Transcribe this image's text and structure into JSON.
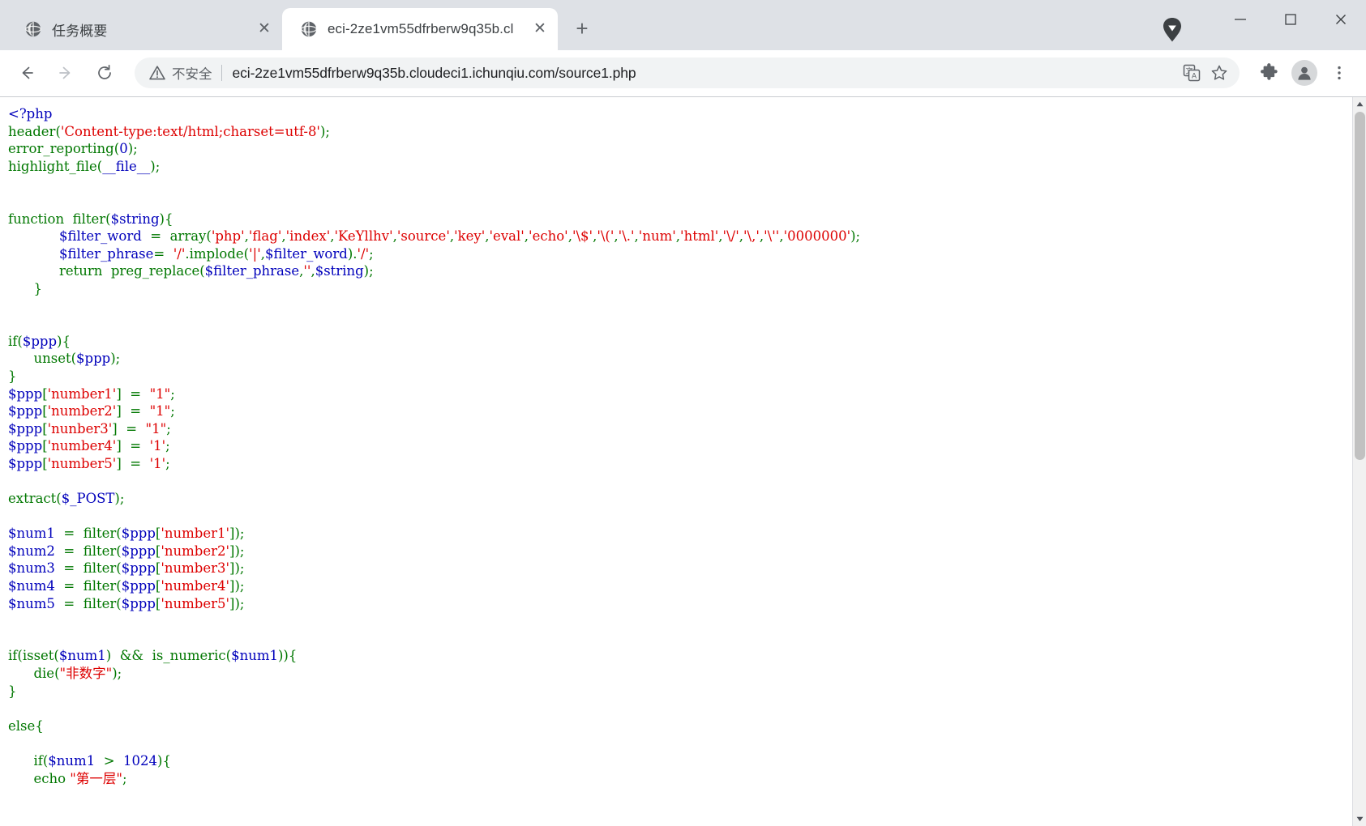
{
  "window": {
    "controls": {
      "minimize_label": "─",
      "maximize_label": "❐",
      "close_label": "✕"
    }
  },
  "tabstrip": {
    "tabs": [
      {
        "title": "任务概要",
        "favicon": "globe-icon",
        "close_label": "✕",
        "active": false
      },
      {
        "title": "eci-2ze1vm55dfrberw9q35b.cl",
        "favicon": "globe-icon",
        "close_label": "✕",
        "active": true
      }
    ],
    "new_tab_label": "+"
  },
  "toolbar": {
    "back_label": "←",
    "forward_label": "→",
    "reload_label": "↻",
    "security": {
      "icon": "warning-triangle-icon",
      "text": "不安全"
    },
    "url": "eci-2ze1vm55dfrberw9q35b.cloudeci1.ichunqiu.com/source1.php",
    "translate_icon": "translate-icon",
    "bookmark_icon": "star-icon",
    "extensions_icon": "puzzle-piece-icon",
    "profile_icon": "person-avatar-icon",
    "menu_icon": "three-dots-vertical-icon"
  },
  "scrollbar": {
    "up_label": "▲",
    "down_label": "▼"
  },
  "page": {
    "colors": {
      "default": "#0000BB",
      "keyword": "#007700",
      "string": "#DD0000",
      "comment": "#FF8000",
      "html": "#000000"
    },
    "code_lines": [
      [
        {
          "t": "<?php",
          "c": "default"
        }
      ],
      [
        {
          "t": "header",
          "c": "keyword"
        },
        {
          "t": "(",
          "c": "keyword"
        },
        {
          "t": "'Content-type:text/html;charset=utf-8'",
          "c": "string"
        },
        {
          "t": ");",
          "c": "keyword"
        }
      ],
      [
        {
          "t": "error_reporting",
          "c": "keyword"
        },
        {
          "t": "(",
          "c": "keyword"
        },
        {
          "t": "0",
          "c": "default"
        },
        {
          "t": ");",
          "c": "keyword"
        }
      ],
      [
        {
          "t": "highlight_file",
          "c": "keyword"
        },
        {
          "t": "(",
          "c": "keyword"
        },
        {
          "t": "__file__",
          "c": "default"
        },
        {
          "t": ");",
          "c": "keyword"
        }
      ],
      [],
      [],
      [
        {
          "t": "function",
          "c": "keyword"
        },
        {
          "t": "  filter(",
          "c": "keyword"
        },
        {
          "t": "$string",
          "c": "default"
        },
        {
          "t": "){",
          "c": "keyword"
        }
      ],
      [
        {
          "t": "            ",
          "c": "keyword"
        },
        {
          "t": "$filter_word",
          "c": "default"
        },
        {
          "t": "  =  ",
          "c": "keyword"
        },
        {
          "t": "array(",
          "c": "keyword"
        },
        {
          "t": "'php'",
          "c": "string"
        },
        {
          "t": ",",
          "c": "keyword"
        },
        {
          "t": "'flag'",
          "c": "string"
        },
        {
          "t": ",",
          "c": "keyword"
        },
        {
          "t": "'index'",
          "c": "string"
        },
        {
          "t": ",",
          "c": "keyword"
        },
        {
          "t": "'KeYllhv'",
          "c": "string"
        },
        {
          "t": ",",
          "c": "keyword"
        },
        {
          "t": "'source'",
          "c": "string"
        },
        {
          "t": ",",
          "c": "keyword"
        },
        {
          "t": "'key'",
          "c": "string"
        },
        {
          "t": ",",
          "c": "keyword"
        },
        {
          "t": "'eval'",
          "c": "string"
        },
        {
          "t": ",",
          "c": "keyword"
        },
        {
          "t": "'echo'",
          "c": "string"
        },
        {
          "t": ",",
          "c": "keyword"
        },
        {
          "t": "'\\$'",
          "c": "string"
        },
        {
          "t": ",",
          "c": "keyword"
        },
        {
          "t": "'\\('",
          "c": "string"
        },
        {
          "t": ",",
          "c": "keyword"
        },
        {
          "t": "'\\.'",
          "c": "string"
        },
        {
          "t": ",",
          "c": "keyword"
        },
        {
          "t": "'num'",
          "c": "string"
        },
        {
          "t": ",",
          "c": "keyword"
        },
        {
          "t": "'html'",
          "c": "string"
        },
        {
          "t": ",",
          "c": "keyword"
        },
        {
          "t": "'\\/'",
          "c": "string"
        },
        {
          "t": ",",
          "c": "keyword"
        },
        {
          "t": "'\\,'",
          "c": "string"
        },
        {
          "t": ",",
          "c": "keyword"
        },
        {
          "t": "'\\''",
          "c": "string"
        },
        {
          "t": ",",
          "c": "keyword"
        },
        {
          "t": "'0000000'",
          "c": "string"
        },
        {
          "t": ");",
          "c": "keyword"
        }
      ],
      [
        {
          "t": "            ",
          "c": "keyword"
        },
        {
          "t": "$filter_phrase",
          "c": "default"
        },
        {
          "t": "=  ",
          "c": "keyword"
        },
        {
          "t": "'/'",
          "c": "string"
        },
        {
          "t": ".implode(",
          "c": "keyword"
        },
        {
          "t": "'|'",
          "c": "string"
        },
        {
          "t": ",",
          "c": "keyword"
        },
        {
          "t": "$filter_word",
          "c": "default"
        },
        {
          "t": ").",
          "c": "keyword"
        },
        {
          "t": "'/'",
          "c": "string"
        },
        {
          "t": ";",
          "c": "keyword"
        }
      ],
      [
        {
          "t": "            return",
          "c": "keyword"
        },
        {
          "t": "  preg_replace(",
          "c": "keyword"
        },
        {
          "t": "$filter_phrase",
          "c": "default"
        },
        {
          "t": ",",
          "c": "keyword"
        },
        {
          "t": "''",
          "c": "string"
        },
        {
          "t": ",",
          "c": "keyword"
        },
        {
          "t": "$string",
          "c": "default"
        },
        {
          "t": ");",
          "c": "keyword"
        }
      ],
      [
        {
          "t": "      }",
          "c": "keyword"
        }
      ],
      [],
      [],
      [
        {
          "t": "if(",
          "c": "keyword"
        },
        {
          "t": "$ppp",
          "c": "default"
        },
        {
          "t": "){",
          "c": "keyword"
        }
      ],
      [
        {
          "t": "      unset(",
          "c": "keyword"
        },
        {
          "t": "$ppp",
          "c": "default"
        },
        {
          "t": ");",
          "c": "keyword"
        }
      ],
      [
        {
          "t": "}",
          "c": "keyword"
        }
      ],
      [
        {
          "t": "$ppp",
          "c": "default"
        },
        {
          "t": "[",
          "c": "keyword"
        },
        {
          "t": "'number1'",
          "c": "string"
        },
        {
          "t": "]  =  ",
          "c": "keyword"
        },
        {
          "t": "\"1\"",
          "c": "string"
        },
        {
          "t": ";",
          "c": "keyword"
        }
      ],
      [
        {
          "t": "$ppp",
          "c": "default"
        },
        {
          "t": "[",
          "c": "keyword"
        },
        {
          "t": "'number2'",
          "c": "string"
        },
        {
          "t": "]  =  ",
          "c": "keyword"
        },
        {
          "t": "\"1\"",
          "c": "string"
        },
        {
          "t": ";",
          "c": "keyword"
        }
      ],
      [
        {
          "t": "$ppp",
          "c": "default"
        },
        {
          "t": "[",
          "c": "keyword"
        },
        {
          "t": "'nunber3'",
          "c": "string"
        },
        {
          "t": "]  =  ",
          "c": "keyword"
        },
        {
          "t": "\"1\"",
          "c": "string"
        },
        {
          "t": ";",
          "c": "keyword"
        }
      ],
      [
        {
          "t": "$ppp",
          "c": "default"
        },
        {
          "t": "[",
          "c": "keyword"
        },
        {
          "t": "'number4'",
          "c": "string"
        },
        {
          "t": "]  =  ",
          "c": "keyword"
        },
        {
          "t": "'1'",
          "c": "string"
        },
        {
          "t": ";",
          "c": "keyword"
        }
      ],
      [
        {
          "t": "$ppp",
          "c": "default"
        },
        {
          "t": "[",
          "c": "keyword"
        },
        {
          "t": "'number5'",
          "c": "string"
        },
        {
          "t": "]  =  ",
          "c": "keyword"
        },
        {
          "t": "'1'",
          "c": "string"
        },
        {
          "t": ";",
          "c": "keyword"
        }
      ],
      [],
      [
        {
          "t": "extract(",
          "c": "keyword"
        },
        {
          "t": "$_POST",
          "c": "default"
        },
        {
          "t": ");",
          "c": "keyword"
        }
      ],
      [],
      [
        {
          "t": "$num1",
          "c": "default"
        },
        {
          "t": "  =  filter(",
          "c": "keyword"
        },
        {
          "t": "$ppp",
          "c": "default"
        },
        {
          "t": "[",
          "c": "keyword"
        },
        {
          "t": "'number1'",
          "c": "string"
        },
        {
          "t": "]);",
          "c": "keyword"
        }
      ],
      [
        {
          "t": "$num2",
          "c": "default"
        },
        {
          "t": "  =  filter(",
          "c": "keyword"
        },
        {
          "t": "$ppp",
          "c": "default"
        },
        {
          "t": "[",
          "c": "keyword"
        },
        {
          "t": "'number2'",
          "c": "string"
        },
        {
          "t": "]);",
          "c": "keyword"
        }
      ],
      [
        {
          "t": "$num3",
          "c": "default"
        },
        {
          "t": "  =  filter(",
          "c": "keyword"
        },
        {
          "t": "$ppp",
          "c": "default"
        },
        {
          "t": "[",
          "c": "keyword"
        },
        {
          "t": "'number3'",
          "c": "string"
        },
        {
          "t": "]);",
          "c": "keyword"
        }
      ],
      [
        {
          "t": "$num4",
          "c": "default"
        },
        {
          "t": "  =  filter(",
          "c": "keyword"
        },
        {
          "t": "$ppp",
          "c": "default"
        },
        {
          "t": "[",
          "c": "keyword"
        },
        {
          "t": "'number4'",
          "c": "string"
        },
        {
          "t": "]);",
          "c": "keyword"
        }
      ],
      [
        {
          "t": "$num5",
          "c": "default"
        },
        {
          "t": "  =  filter(",
          "c": "keyword"
        },
        {
          "t": "$ppp",
          "c": "default"
        },
        {
          "t": "[",
          "c": "keyword"
        },
        {
          "t": "'number5'",
          "c": "string"
        },
        {
          "t": "]);",
          "c": "keyword"
        }
      ],
      [],
      [],
      [
        {
          "t": "if(isset(",
          "c": "keyword"
        },
        {
          "t": "$num1",
          "c": "default"
        },
        {
          "t": ")  &&  is_numeric(",
          "c": "keyword"
        },
        {
          "t": "$num1",
          "c": "default"
        },
        {
          "t": ")){",
          "c": "keyword"
        }
      ],
      [
        {
          "t": "      die(",
          "c": "keyword"
        },
        {
          "t": "\"非数字\"",
          "c": "string"
        },
        {
          "t": ");",
          "c": "keyword"
        }
      ],
      [
        {
          "t": "}",
          "c": "keyword"
        }
      ],
      [],
      [
        {
          "t": "else{",
          "c": "keyword"
        }
      ],
      [],
      [
        {
          "t": "      if(",
          "c": "keyword"
        },
        {
          "t": "$num1",
          "c": "default"
        },
        {
          "t": "  >  ",
          "c": "keyword"
        },
        {
          "t": "1024",
          "c": "default"
        },
        {
          "t": "){",
          "c": "keyword"
        }
      ],
      [
        {
          "t": "      echo ",
          "c": "keyword"
        },
        {
          "t": "\"第一层\"",
          "c": "string"
        },
        {
          "t": ";",
          "c": "keyword"
        }
      ]
    ]
  }
}
